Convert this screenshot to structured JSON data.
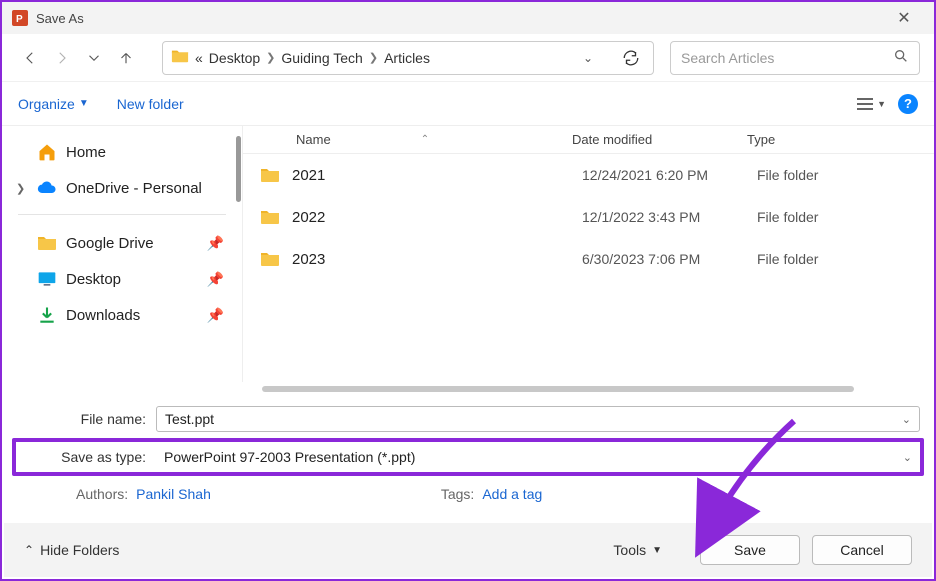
{
  "window": {
    "title": "Save As",
    "close": "✕"
  },
  "nav": {
    "crumb_prefix": "«",
    "crumbs": [
      "Desktop",
      "Guiding Tech",
      "Articles"
    ]
  },
  "search": {
    "placeholder": "Search Articles"
  },
  "toolbar": {
    "organize": "Organize",
    "new_folder": "New folder"
  },
  "sidebar": {
    "home": "Home",
    "onedrive": "OneDrive - Personal",
    "gdrive": "Google Drive",
    "desktop": "Desktop",
    "downloads": "Downloads"
  },
  "headers": {
    "name": "Name",
    "date": "Date modified",
    "type": "Type"
  },
  "files": [
    {
      "name": "2021",
      "date": "12/24/2021 6:20 PM",
      "type": "File folder"
    },
    {
      "name": "2022",
      "date": "12/1/2022 3:43 PM",
      "type": "File folder"
    },
    {
      "name": "2023",
      "date": "6/30/2023 7:06 PM",
      "type": "File folder"
    }
  ],
  "form": {
    "filename_label": "File name:",
    "filename_value": "Test.ppt",
    "savetype_label": "Save as type:",
    "savetype_value": "PowerPoint 97-2003 Presentation (*.ppt)",
    "authors_label": "Authors:",
    "authors_value": "Pankil Shah",
    "tags_label": "Tags:",
    "tags_value": "Add a tag"
  },
  "footer": {
    "hide_folders": "Hide Folders",
    "tools": "Tools",
    "save": "Save",
    "cancel": "Cancel"
  },
  "colors": {
    "accent": "#8a28d9",
    "link": "#1a66d1"
  }
}
